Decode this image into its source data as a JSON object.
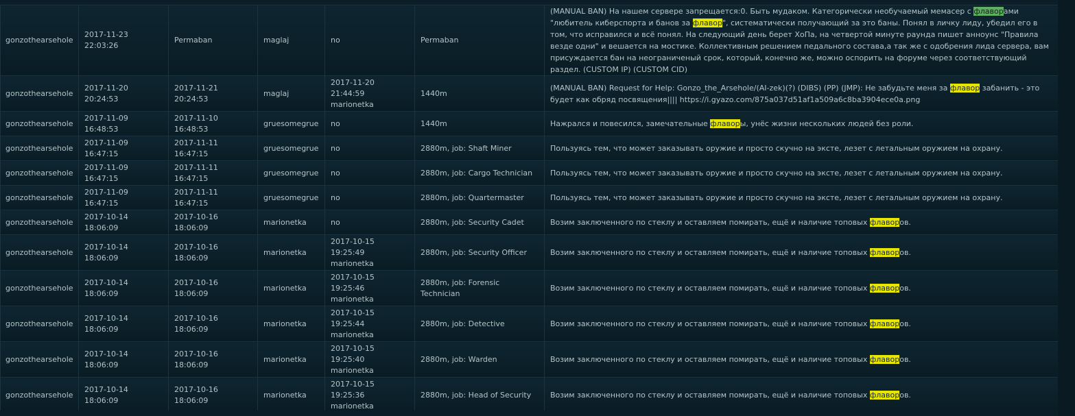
{
  "highlight_term": "флавор",
  "colors": {
    "background": "#0a1a22",
    "row_bg": "#0e2530",
    "border": "#1c3440",
    "text": "#b4c4c8",
    "highlight_yellow": "#e6e600",
    "highlight_green": "#5db060"
  },
  "rows": [
    {
      "ckey": "gonzothearsehole",
      "bantime": "2017-11-23 22:03:26",
      "expiration": "Permaban",
      "admin": "maglaj",
      "unbanned": "no",
      "unbanned_by": "",
      "duration": "Permaban",
      "reason": "(MANUAL BAN) На нашем сервере запрещается:0. Быть мудаком. Категорически необучаемый мемасер с флаворами \"любитель киберспорта и банов за флавор\", систематически получающий за это баны. Понял в личку лиду, убедил его в том, что исправился и всё понял. На следующий день берет ХоПа, на четвертой минуте раунда пишет анноунс \"Правила везде одни\" и вешается на мостике. Коллективным решением педального состава,а так же с одобрения лида сервера, вам присуждается бан на неограниченый срок, который, конечно же, можно оспорить на форуме через соответствующий раздел. (CUSTOM IP) (CUSTOM CID)"
    },
    {
      "ckey": "gonzothearsehole",
      "bantime": "2017-11-20 20:24:53",
      "expiration": "2017-11-21 20:24:53",
      "admin": "maglaj",
      "unbanned": "2017-11-20 21:44:59",
      "unbanned_by": "marionetka",
      "duration": "1440m",
      "reason": "(MANUAL BAN) Request for Help: Gonzo_the_Arsehole/(AI-zek)(?) (DIBS) (PP) (JMP): Не забудьте меня за флавор забанить - это будет как обряд посвящения|||| https://i.gyazo.com/875a037d51af1a509a6c8ba3904ece0a.png"
    },
    {
      "ckey": "gonzothearsehole",
      "bantime": "2017-11-09 16:48:53",
      "expiration": "2017-11-10 16:48:53",
      "admin": "gruesomegrue",
      "unbanned": "no",
      "unbanned_by": "",
      "duration": "1440m",
      "reason": "Нажрался и повесился, замечательные флаворы, унёс жизни нескольких людей без роли."
    },
    {
      "ckey": "gonzothearsehole",
      "bantime": "2017-11-09 16:47:15",
      "expiration": "2017-11-11 16:47:15",
      "admin": "gruesomegrue",
      "unbanned": "no",
      "unbanned_by": "",
      "duration": "2880m, job: Shaft Miner",
      "reason": "Пользуясь тем, что может заказывать оружие и просто скучно на эксте, лезет с летальным оружием на охрану."
    },
    {
      "ckey": "gonzothearsehole",
      "bantime": "2017-11-09 16:47:15",
      "expiration": "2017-11-11 16:47:15",
      "admin": "gruesomegrue",
      "unbanned": "no",
      "unbanned_by": "",
      "duration": "2880m, job: Cargo Technician",
      "reason": "Пользуясь тем, что может заказывать оружие и просто скучно на эксте, лезет с летальным оружием на охрану."
    },
    {
      "ckey": "gonzothearsehole",
      "bantime": "2017-11-09 16:47:15",
      "expiration": "2017-11-11 16:47:15",
      "admin": "gruesomegrue",
      "unbanned": "no",
      "unbanned_by": "",
      "duration": "2880m, job: Quartermaster",
      "reason": "Пользуясь тем, что может заказывать оружие и просто скучно на эксте, лезет с летальным оружием на охрану."
    },
    {
      "ckey": "gonzothearsehole",
      "bantime": "2017-10-14 18:06:09",
      "expiration": "2017-10-16 18:06:09",
      "admin": "marionetka",
      "unbanned": "no",
      "unbanned_by": "",
      "duration": "2880m, job: Security Cadet",
      "reason": "Возим заключенного по стеклу и оставляем помирать, ещё и наличие топовых флаворов."
    },
    {
      "ckey": "gonzothearsehole",
      "bantime": "2017-10-14 18:06:09",
      "expiration": "2017-10-16 18:06:09",
      "admin": "marionetka",
      "unbanned": "2017-10-15 19:25:49",
      "unbanned_by": "marionetka",
      "duration": "2880m, job: Security Officer",
      "reason": "Возим заключенного по стеклу и оставляем помирать, ещё и наличие топовых флаворов."
    },
    {
      "ckey": "gonzothearsehole",
      "bantime": "2017-10-14 18:06:09",
      "expiration": "2017-10-16 18:06:09",
      "admin": "marionetka",
      "unbanned": "2017-10-15 19:25:46",
      "unbanned_by": "marionetka",
      "duration": "2880m, job: Forensic Technician",
      "reason": "Возим заключенного по стеклу и оставляем помирать, ещё и наличие топовых флаворов."
    },
    {
      "ckey": "gonzothearsehole",
      "bantime": "2017-10-14 18:06:09",
      "expiration": "2017-10-16 18:06:09",
      "admin": "marionetka",
      "unbanned": "2017-10-15 19:25:44",
      "unbanned_by": "marionetka",
      "duration": "2880m, job: Detective",
      "reason": "Возим заключенного по стеклу и оставляем помирать, ещё и наличие топовых флаворов."
    },
    {
      "ckey": "gonzothearsehole",
      "bantime": "2017-10-14 18:06:09",
      "expiration": "2017-10-16 18:06:09",
      "admin": "marionetka",
      "unbanned": "2017-10-15 19:25:40",
      "unbanned_by": "marionetka",
      "duration": "2880m, job: Warden",
      "reason": "Возим заключенного по стеклу и оставляем помирать, ещё и наличие топовых флаворов."
    },
    {
      "ckey": "gonzothearsehole",
      "bantime": "2017-10-14 18:06:09",
      "expiration": "2017-10-16 18:06:09",
      "admin": "marionetka",
      "unbanned": "2017-10-15 19:25:36",
      "unbanned_by": "marionetka",
      "duration": "2880m, job: Head of Security",
      "reason": "Возим заключенного по стеклу и оставляем помирать, ещё и наличие топовых флаворов."
    }
  ]
}
